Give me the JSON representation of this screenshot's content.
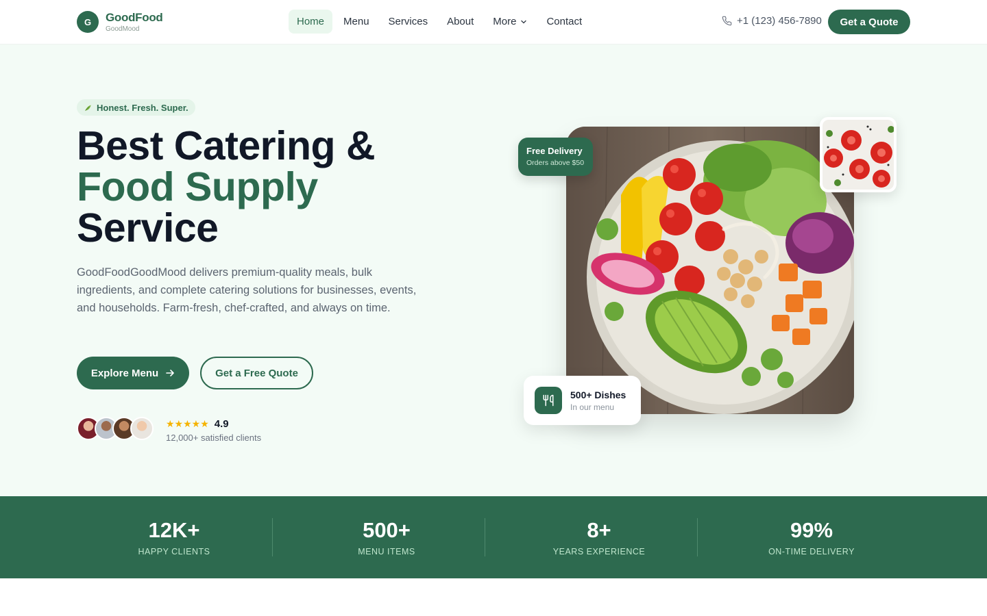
{
  "brand": {
    "name": "GoodFood",
    "tagline": "GoodMood",
    "initial": "G"
  },
  "nav": {
    "items": [
      {
        "label": "Home",
        "active": true
      },
      {
        "label": "Menu"
      },
      {
        "label": "Services"
      },
      {
        "label": "About"
      },
      {
        "label": "More",
        "dropdown": true
      },
      {
        "label": "Contact"
      }
    ]
  },
  "header": {
    "phone": "+1 (123) 456-7890",
    "cta": "Get a Quote"
  },
  "hero": {
    "tag": "Honest. Fresh. Super.",
    "title_line1": "Best Catering &",
    "title_line2": "Food Supply",
    "title_line3": "Service",
    "description": "GoodFoodGoodMood delivers premium-quality meals, bulk ingredients, and complete catering solutions for businesses, events, and households. Farm-fresh, chef-crafted, and always on time.",
    "primary_cta": "Explore Menu",
    "secondary_cta": "Get a Free Quote",
    "stars": "★★★★★",
    "rating": "4.9",
    "clients": "12,000+ satisfied clients"
  },
  "badges": {
    "delivery_title": "Free Delivery",
    "delivery_sub": "Orders above $50",
    "dishes_title": "500+ Dishes",
    "dishes_sub": "In our menu"
  },
  "stats": [
    {
      "value": "12K+",
      "label": "HAPPY CLIENTS"
    },
    {
      "value": "500+",
      "label": "MENU ITEMS"
    },
    {
      "value": "8+",
      "label": "YEARS EXPERIENCE"
    },
    {
      "value": "99%",
      "label": "ON-TIME DELIVERY"
    }
  ],
  "colors": {
    "brand": "#2d6a4f",
    "hero_bg": "#f3fbf6",
    "star": "#f5b301"
  }
}
